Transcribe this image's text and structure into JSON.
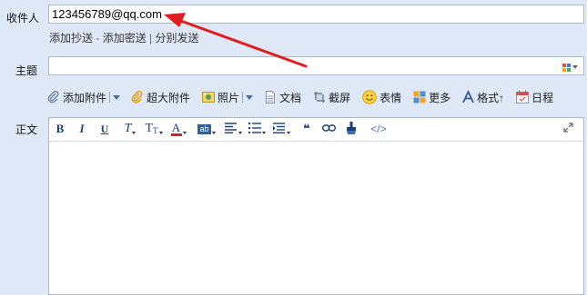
{
  "recipient": {
    "label": "收件人",
    "value": "123456789@qq.com"
  },
  "links": {
    "add_cc": "添加抄送",
    "add_bcc": "添加密送",
    "sep": " - ",
    "divider": "|",
    "separate_send": "分别发送"
  },
  "subject": {
    "label": "主题",
    "value": ""
  },
  "toolbar": {
    "attachment": "添加附件",
    "big_attachment": "超大附件",
    "photo": "照片",
    "document": "文档",
    "screenshot": "截屏",
    "emoji": "表情",
    "more": "更多",
    "format": "格式↑",
    "calendar": "日程"
  },
  "body": {
    "label": "正文"
  },
  "editor": {
    "bold": "B",
    "italic": "I",
    "underline": "U",
    "font": "T",
    "font_size": "T",
    "font_color": "A",
    "bg_color": "ab",
    "quote": "❝",
    "code": "</>"
  },
  "annotation_color": "#e02020"
}
